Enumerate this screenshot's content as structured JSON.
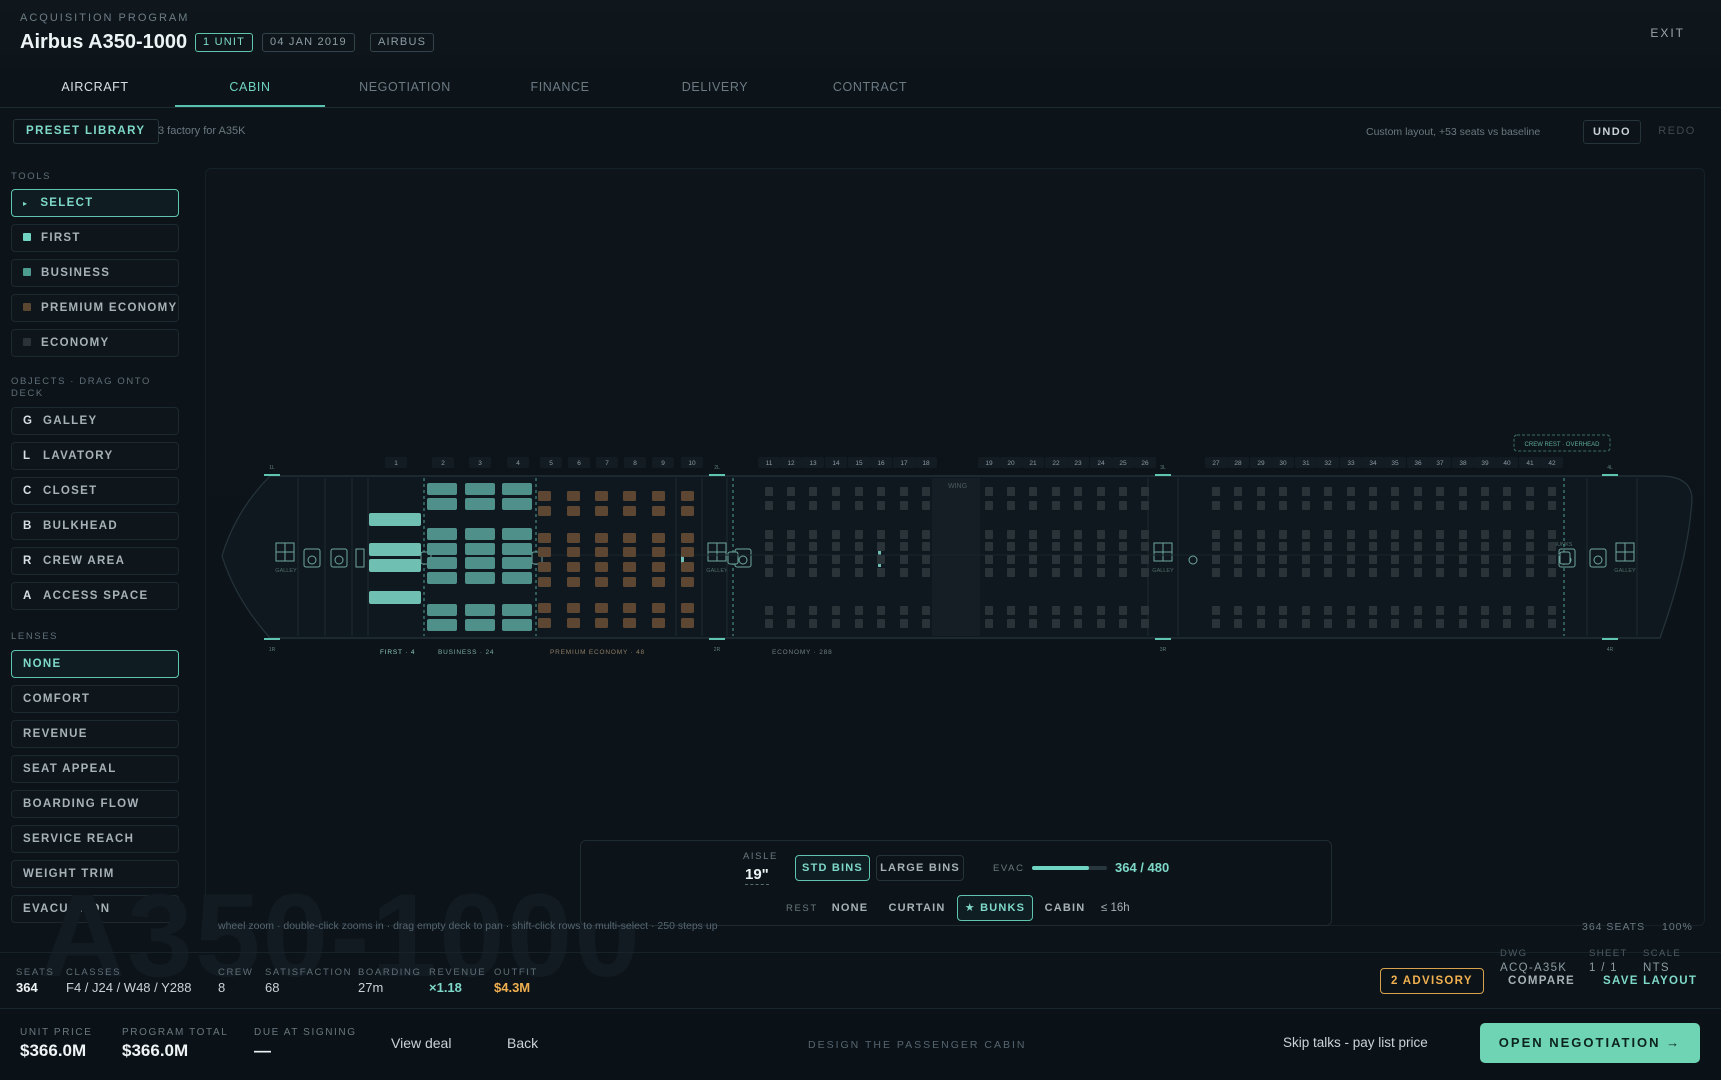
{
  "header": {
    "kicker": "ACQUISITION PROGRAM",
    "title": "Airbus A350-1000",
    "chips": [
      "1 UNIT",
      "04 JAN 2019",
      "AIRBUS"
    ],
    "exit": "EXIT"
  },
  "tabs": [
    "AIRCRAFT",
    "CABIN",
    "NEGOTIATION",
    "FINANCE",
    "DELIVERY",
    "CONTRACT"
  ],
  "active_tab": "CABIN",
  "toolbar": {
    "preset": "PRESET LIBRARY",
    "preset_note": "3 factory for A35K",
    "layout_note": "Custom layout, +53 seats vs baseline",
    "undo": "UNDO",
    "redo": "REDO"
  },
  "tools": {
    "label": "TOOLS",
    "items": [
      {
        "label": "SELECT",
        "mark": "▸"
      },
      {
        "label": "FIRST",
        "color": "#6fd4c1"
      },
      {
        "label": "BUSINESS",
        "color": "#4e9c90"
      },
      {
        "label": "PREMIUM ECONOMY",
        "color": "#5a4631"
      },
      {
        "label": "ECONOMY",
        "color": "#2b3338"
      }
    ]
  },
  "objects": {
    "label": "OBJECTS · DRAG ONTO DECK",
    "items": [
      {
        "key": "G",
        "label": "GALLEY"
      },
      {
        "key": "L",
        "label": "LAVATORY"
      },
      {
        "key": "C",
        "label": "CLOSET"
      },
      {
        "key": "B",
        "label": "BULKHEAD"
      },
      {
        "key": "R",
        "label": "CREW AREA"
      },
      {
        "key": "A",
        "label": "ACCESS SPACE"
      }
    ]
  },
  "lenses": {
    "label": "LENSES",
    "items": [
      "NONE",
      "COMFORT",
      "REVENUE",
      "SEAT APPEAL",
      "BOARDING FLOW",
      "SERVICE REACH",
      "WEIGHT TRIM",
      "EVACUATION"
    ]
  },
  "deck": {
    "crew_rest": "CREW REST · OVERHEAD",
    "wing": "WING",
    "galley": "GALLEY",
    "bunks": "BUNKS",
    "row_numbers": [
      "1",
      "2",
      "3",
      "4",
      "5",
      "6",
      "7",
      "8",
      "9",
      "10",
      "11",
      "12",
      "13",
      "14",
      "15",
      "16",
      "17",
      "18",
      "19",
      "20",
      "21",
      "22",
      "23",
      "24",
      "25",
      "26",
      "27",
      "28",
      "29",
      "30",
      "31",
      "32",
      "33",
      "34",
      "35",
      "36",
      "37",
      "38",
      "39",
      "40",
      "41",
      "42"
    ],
    "door_labels": [
      "1L",
      "1R",
      "2L",
      "2R",
      "3L",
      "3R",
      "4L",
      "4R"
    ],
    "class_labels": [
      "FIRST · 4",
      "BUSINESS · 24",
      "PREMIUM ECONOMY · 48",
      "ECONOMY · 288"
    ],
    "colors": {
      "first": "#6fbfb3",
      "business": "#4f918a",
      "premium": "#5d4732",
      "economy": "#2a3338",
      "accent": "#5fc4b0"
    }
  },
  "controls": {
    "aisle_label": "AISLE",
    "aisle_value": "19\"",
    "bins": [
      "STD BINS",
      "LARGE BINS"
    ],
    "evac_label": "EVAC",
    "evac_value": "364 / 480",
    "evac_fraction": 0.758,
    "rest_label": "REST",
    "rest_options": [
      "NONE",
      "CURTAIN",
      "★ BUNKS",
      "CABIN"
    ],
    "rest_limit": "≤ 16h"
  },
  "hint": "wheel zoom · double-click zooms in · drag empty deck to pan · shift-click rows to multi-select · 250 steps up",
  "watermark": "A350-1000",
  "canvas_status": {
    "seats": "364 SEATS",
    "zoom": "100%"
  },
  "stats": [
    {
      "label": "SEATS",
      "value": "364"
    },
    {
      "label": "CLASSES",
      "value": "F4 / J24 / W48 / Y288"
    },
    {
      "label": "CREW",
      "value": "8"
    },
    {
      "label": "SATISFACTION",
      "value": "68"
    },
    {
      "label": "BOARDING",
      "value": "27m"
    },
    {
      "label": "REVENUE",
      "value": "×1.18"
    },
    {
      "label": "OUTFIT",
      "value": "$4.3M"
    }
  ],
  "advisory": "2 ADVISORY",
  "drawing": {
    "dwg_label": "DWG",
    "dwg_value": "ACQ-A35K",
    "sheet_label": "SHEET",
    "sheet_value": "1 / 1",
    "scale_label": "SCALE",
    "scale_value": "NTS",
    "compare": "COMPARE",
    "save": "SAVE LAYOUT"
  },
  "footer": {
    "unit_price_label": "UNIT PRICE",
    "unit_price": "$366.0M",
    "program_total_label": "PROGRAM TOTAL",
    "program_total": "$366.0M",
    "due_label": "DUE AT SIGNING",
    "due": "—",
    "view_deal": "View deal",
    "back": "Back",
    "center": "DESIGN THE PASSENGER CABIN",
    "skip": "Skip talks - pay list price",
    "cta": "OPEN NEGOTIATION →"
  }
}
